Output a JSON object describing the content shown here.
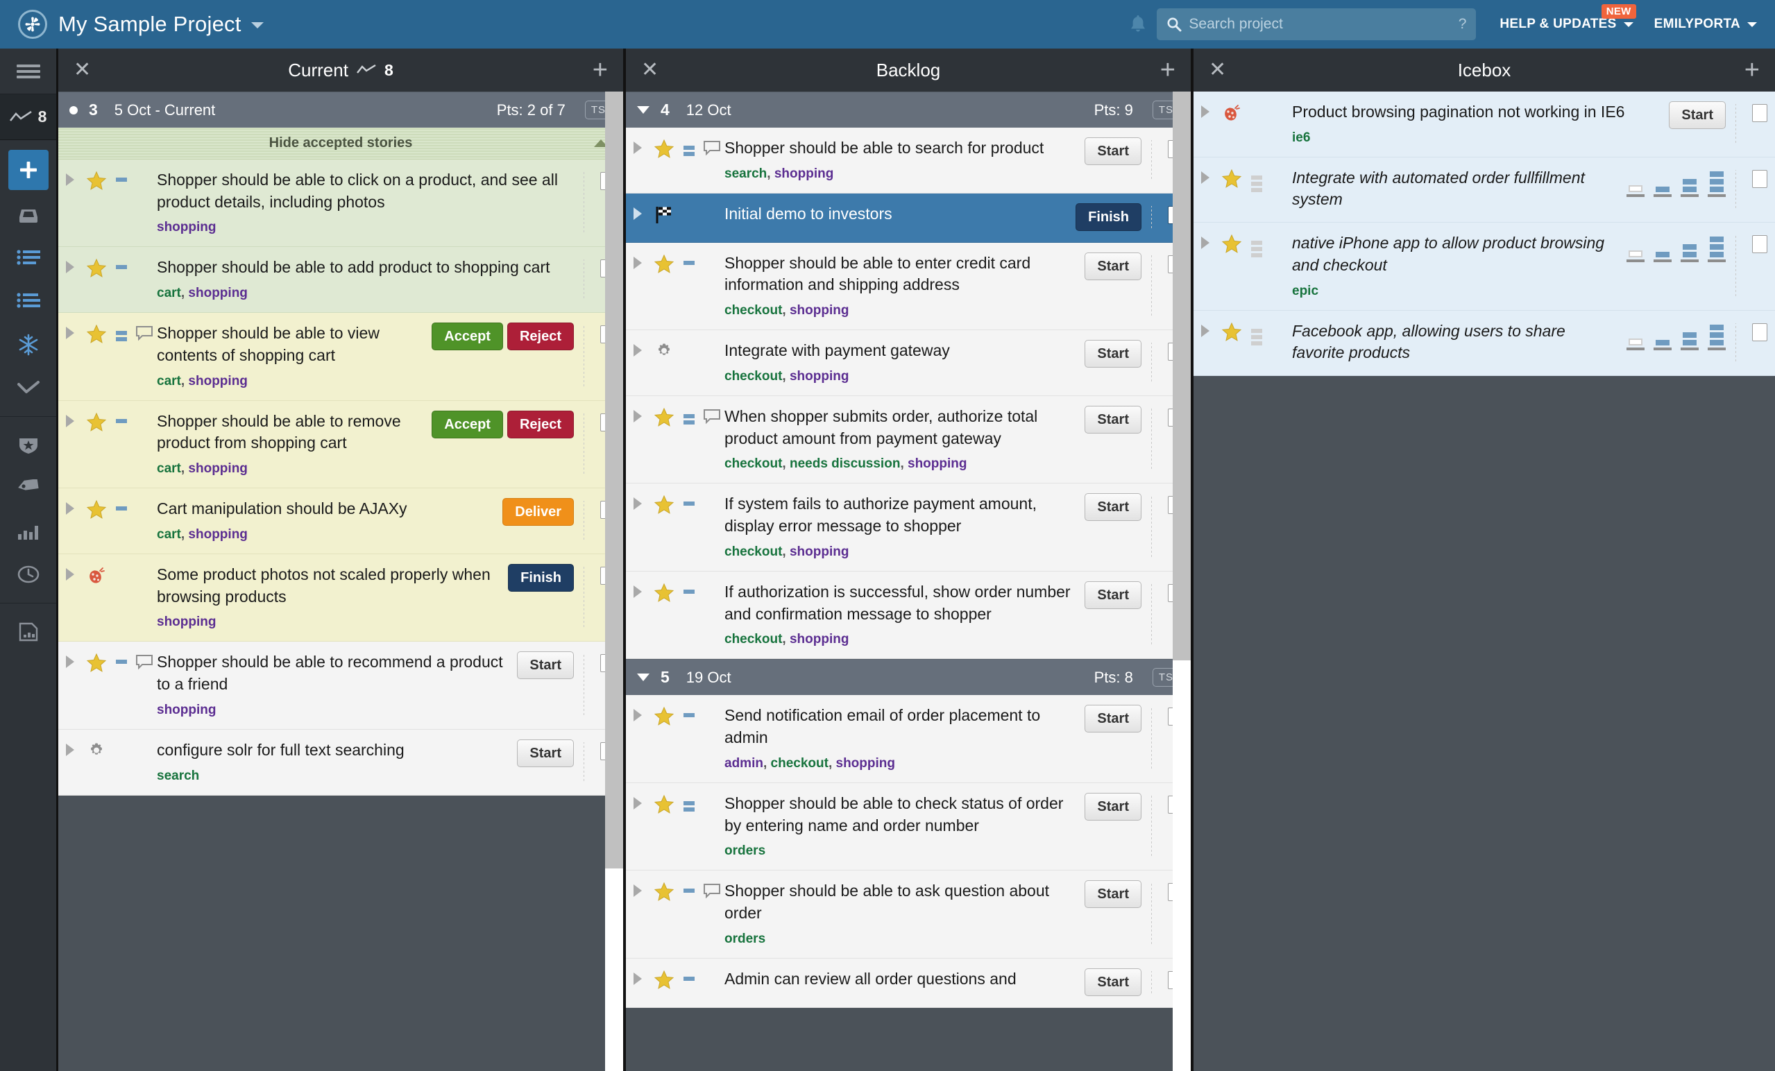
{
  "topbar": {
    "logo_icon": "pivotal-tracker-logo-icon",
    "project_title": "My Sample Project",
    "project_caret_icon": "chevron-down-icon",
    "bell_icon": "notification-bell-icon",
    "search": {
      "icon": "search-icon",
      "placeholder": "Search project",
      "value": "",
      "help_glyph": "?"
    },
    "help_label": "HELP & UPDATES",
    "help_badge": "NEW",
    "user_label": "EMILYPORTA",
    "accent_color": "#2a6590",
    "badge_color": "#f0643c"
  },
  "sidebar": {
    "hamburger_icon": "hamburger-menu-icon",
    "velocity_icon": "velocity-chart-icon",
    "velocity_value": "8",
    "add_icon": "plus-icon",
    "items": [
      {
        "icon": "inbox-icon",
        "name": "my-work"
      },
      {
        "icon": "list-icon",
        "name": "current-backlog"
      },
      {
        "icon": "list-alt-icon",
        "name": "backlog"
      },
      {
        "icon": "snowflake-icon",
        "name": "icebox"
      },
      {
        "icon": "checkmark-icon",
        "name": "done"
      }
    ],
    "items2": [
      {
        "icon": "shield-star-icon",
        "name": "epics"
      },
      {
        "icon": "tag-icon",
        "name": "labels"
      },
      {
        "icon": "bar-chart-icon",
        "name": "analytics"
      },
      {
        "icon": "clock-icon",
        "name": "history"
      }
    ],
    "items3": [
      {
        "icon": "document-chart-icon",
        "name": "reports"
      }
    ]
  },
  "panels": [
    {
      "name": "current",
      "close_icon": "close-icon",
      "title": "Current",
      "velocity_icon": "velocity-chart-icon",
      "velocity_value": "8",
      "add_icon": "plus-icon",
      "iteration": {
        "marker": "dot",
        "number": "3",
        "date": "5 Oct - Current",
        "points": "Pts: 2 of 7",
        "ts_label": "TS"
      },
      "hide_accepted_label": "Hide accepted stories",
      "hide_accepted_chevron": "chevron-up-icon",
      "stories": [
        {
          "state": "accepted",
          "type": "feature",
          "estimate": 1,
          "has_comment": false,
          "title": "Shopper should be able to click on a product, and see all product details, including photos",
          "labels": [
            {
              "text": "shopping",
              "color": "purple"
            }
          ],
          "action": null,
          "checkbox": true
        },
        {
          "state": "accepted",
          "type": "feature",
          "estimate": 1,
          "has_comment": false,
          "title": "Shopper should be able to add product to shopping cart",
          "labels": [
            {
              "text": "cart",
              "color": "green"
            },
            {
              "text": "shopping",
              "color": "purple"
            }
          ],
          "action": null,
          "checkbox": true
        },
        {
          "state": "delivered",
          "type": "feature",
          "estimate": 2,
          "has_comment": true,
          "title": "Shopper should be able to view contents of shopping cart",
          "labels": [
            {
              "text": "cart",
              "color": "green"
            },
            {
              "text": "shopping",
              "color": "purple"
            }
          ],
          "action": "accept-reject",
          "accept_label": "Accept",
          "reject_label": "Reject",
          "checkbox": true
        },
        {
          "state": "delivered",
          "type": "feature",
          "estimate": 1,
          "has_comment": false,
          "title": "Shopper should be able to remove product from shopping cart",
          "labels": [
            {
              "text": "cart",
              "color": "green"
            },
            {
              "text": "shopping",
              "color": "purple"
            }
          ],
          "action": "accept-reject",
          "accept_label": "Accept",
          "reject_label": "Reject",
          "checkbox": true
        },
        {
          "state": "delivered",
          "type": "feature",
          "estimate": 1,
          "has_comment": false,
          "title": "Cart manipulation should be AJAXy",
          "labels": [
            {
              "text": "cart",
              "color": "green"
            },
            {
              "text": "shopping",
              "color": "purple"
            }
          ],
          "action": "deliver",
          "action_label": "Deliver",
          "checkbox": true
        },
        {
          "state": "delivered",
          "type": "bug",
          "estimate": null,
          "has_comment": false,
          "title": "Some product photos not scaled properly when browsing products",
          "labels": [
            {
              "text": "shopping",
              "color": "purple"
            }
          ],
          "action": "finish",
          "action_label": "Finish",
          "checkbox": true
        },
        {
          "state": "normal",
          "type": "feature",
          "estimate": 1,
          "has_comment": true,
          "title": "Shopper should be able to recommend a product to a friend",
          "labels": [
            {
              "text": "shopping",
              "color": "purple"
            }
          ],
          "action": "start",
          "action_label": "Start",
          "checkbox": true
        },
        {
          "state": "normal",
          "type": "chore",
          "estimate": null,
          "has_comment": false,
          "title": "configure solr for full text searching",
          "labels": [
            {
              "text": "search",
              "color": "green"
            }
          ],
          "action": "start",
          "action_label": "Start",
          "checkbox": true
        }
      ]
    },
    {
      "name": "backlog",
      "close_icon": "close-icon",
      "title": "Backlog",
      "add_icon": "plus-icon",
      "iterations": [
        {
          "marker": "triangle",
          "number": "4",
          "date": "12 Oct",
          "points": "Pts: 9",
          "ts_label": "TS",
          "stories": [
            {
              "state": "normal",
              "type": "feature",
              "estimate": 2,
              "has_comment": true,
              "title": "Shopper should be able to search for product",
              "labels": [
                {
                  "text": "search",
                  "color": "green"
                },
                {
                  "text": "shopping",
                  "color": "purple"
                }
              ],
              "action": "start",
              "action_label": "Start",
              "checkbox": true
            },
            {
              "state": "selected",
              "type": "release",
              "estimate": null,
              "has_comment": false,
              "title": "Initial demo to investors",
              "labels": [],
              "action": "finish",
              "action_label": "Finish",
              "checkbox": true
            },
            {
              "state": "normal",
              "type": "feature",
              "estimate": 1,
              "has_comment": false,
              "title": "Shopper should be able to enter credit card information and shipping address",
              "labels": [
                {
                  "text": "checkout",
                  "color": "green"
                },
                {
                  "text": "shopping",
                  "color": "purple"
                }
              ],
              "action": "start",
              "action_label": "Start",
              "checkbox": true
            },
            {
              "state": "normal",
              "type": "chore",
              "estimate": null,
              "has_comment": false,
              "title": "Integrate with payment gateway",
              "labels": [
                {
                  "text": "checkout",
                  "color": "green"
                },
                {
                  "text": "shopping",
                  "color": "purple"
                }
              ],
              "action": "start",
              "action_label": "Start",
              "checkbox": true
            },
            {
              "state": "normal",
              "type": "feature",
              "estimate": 2,
              "has_comment": true,
              "title": "When shopper submits order, authorize total product amount from payment gateway",
              "labels": [
                {
                  "text": "checkout",
                  "color": "green"
                },
                {
                  "text": "needs discussion",
                  "color": "green"
                },
                {
                  "text": "shopping",
                  "color": "purple"
                }
              ],
              "action": "start",
              "action_label": "Start",
              "checkbox": true
            },
            {
              "state": "normal",
              "type": "feature",
              "estimate": 1,
              "has_comment": false,
              "title": "If system fails to authorize payment amount, display error message to shopper",
              "labels": [
                {
                  "text": "checkout",
                  "color": "green"
                },
                {
                  "text": "shopping",
                  "color": "purple"
                }
              ],
              "action": "start",
              "action_label": "Start",
              "checkbox": true
            },
            {
              "state": "normal",
              "type": "feature",
              "estimate": 1,
              "has_comment": false,
              "title": "If authorization is successful, show order number and confirmation message to shopper",
              "labels": [
                {
                  "text": "checkout",
                  "color": "green"
                },
                {
                  "text": "shopping",
                  "color": "purple"
                }
              ],
              "action": "start",
              "action_label": "Start",
              "checkbox": true
            }
          ]
        },
        {
          "marker": "triangle",
          "number": "5",
          "date": "19 Oct",
          "points": "Pts: 8",
          "ts_label": "TS",
          "stories": [
            {
              "state": "normal",
              "type": "feature",
              "estimate": 1,
              "has_comment": false,
              "title": "Send notification email of order placement to admin",
              "labels": [
                {
                  "text": "admin",
                  "color": "purple"
                },
                {
                  "text": "checkout",
                  "color": "green"
                },
                {
                  "text": "shopping",
                  "color": "purple"
                }
              ],
              "action": "start",
              "action_label": "Start",
              "checkbox": true
            },
            {
              "state": "normal",
              "type": "feature",
              "estimate": 2,
              "has_comment": false,
              "title": "Shopper should be able to check status of order by entering name and order number",
              "labels": [
                {
                  "text": "orders",
                  "color": "green"
                }
              ],
              "action": "start",
              "action_label": "Start",
              "checkbox": true
            },
            {
              "state": "normal",
              "type": "feature",
              "estimate": 1,
              "has_comment": true,
              "title": "Shopper should be able to ask question about order",
              "labels": [
                {
                  "text": "orders",
                  "color": "green"
                }
              ],
              "action": "start",
              "action_label": "Start",
              "checkbox": true
            },
            {
              "state": "normal",
              "type": "feature",
              "estimate": 1,
              "has_comment": false,
              "title": "Admin can review all order questions and",
              "labels": [],
              "action": "start",
              "action_label": "Start",
              "checkbox": true
            }
          ]
        }
      ]
    },
    {
      "name": "icebox",
      "close_icon": "close-icon",
      "title": "Icebox",
      "add_icon": "plus-icon",
      "stories": [
        {
          "state": "icebox",
          "type": "bug",
          "estimate": null,
          "has_comment": false,
          "title": "Product browsing pagination not working in IE6",
          "italic": false,
          "labels": [
            {
              "text": "ie6",
              "color": "green"
            }
          ],
          "action": "start",
          "action_label": "Start",
          "checkbox": true
        },
        {
          "state": "icebox",
          "type": "feature",
          "estimate": null,
          "estimate_unset": true,
          "has_comment": false,
          "title": "Integrate with automated order fullfillment system",
          "italic": true,
          "labels": [],
          "action": "estimate-picker",
          "checkbox": true
        },
        {
          "state": "icebox",
          "type": "feature",
          "estimate": null,
          "estimate_unset": true,
          "has_comment": false,
          "title": "native iPhone app to allow product browsing and checkout",
          "italic": true,
          "labels": [
            {
              "text": "epic",
              "color": "green"
            }
          ],
          "action": "estimate-picker",
          "checkbox": true
        },
        {
          "state": "icebox",
          "type": "feature",
          "estimate": null,
          "estimate_unset": true,
          "has_comment": false,
          "title": "Facebook app, allowing users to share favorite products",
          "italic": true,
          "labels": [],
          "action": "estimate-picker",
          "checkbox": true
        }
      ],
      "estimate_options": [
        "0",
        "1",
        "2",
        "3"
      ]
    }
  ]
}
